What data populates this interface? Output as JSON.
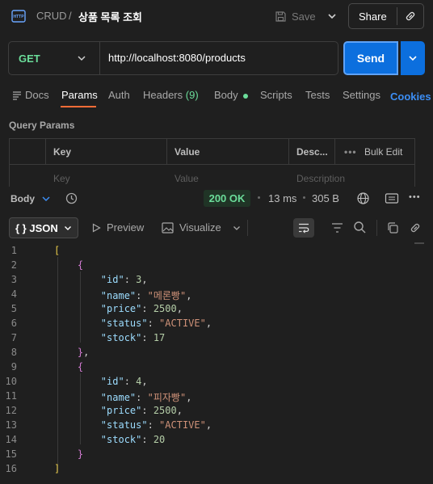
{
  "header": {
    "breadcrumb_root": "CRUD",
    "breadcrumb_sep": "/",
    "request_title": "상품 목록 조회",
    "save_label": "Save",
    "share_label": "Share"
  },
  "request": {
    "method": "GET",
    "url": "http://localhost:8080/products",
    "send_label": "Send"
  },
  "tabs": {
    "docs": "Docs",
    "params": "Params",
    "auth": "Auth",
    "headers": "Headers",
    "headers_count": "(9)",
    "body": "Body",
    "scripts": "Scripts",
    "tests": "Tests",
    "settings": "Settings",
    "cookies": "Cookies"
  },
  "query_params": {
    "title": "Query Params",
    "columns": [
      "Key",
      "Value",
      "Desc...",
      "Bulk Edit"
    ],
    "placeholders": [
      "Key",
      "Value",
      "Description"
    ]
  },
  "response": {
    "body_label": "Body",
    "status": "200 OK",
    "time": "13 ms",
    "size": "305 B",
    "format_label": "JSON",
    "format_prefix": "{ }",
    "preview_label": "Preview",
    "visualize_label": "Visualize"
  },
  "editor": {
    "line_numbers": [
      "1",
      "2",
      "3",
      "4",
      "5",
      "6",
      "7",
      "8",
      "9",
      "10",
      "11",
      "12",
      "13",
      "14",
      "15",
      "16"
    ],
    "keys": {
      "id": "\"id\"",
      "name": "\"name\"",
      "price": "\"price\"",
      "status": "\"status\"",
      "stock": "\"stock\""
    },
    "items": [
      {
        "id": "3",
        "name": "\"메론빵\"",
        "price": "2500",
        "status": "\"ACTIVE\"",
        "stock": "17"
      },
      {
        "id": "4",
        "name": "\"피자빵\"",
        "price": "2500",
        "status": "\"ACTIVE\"",
        "stock": "20"
      }
    ]
  }
}
